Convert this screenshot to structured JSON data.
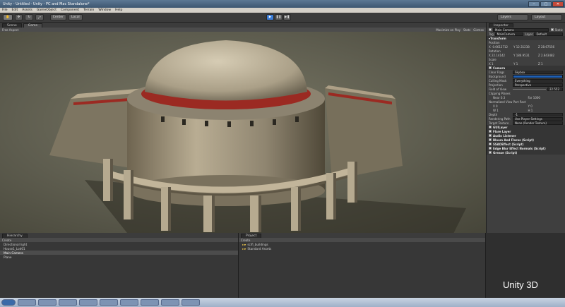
{
  "window": {
    "title": "Unity - Untitled - Unity - PC and Mac Standalone*"
  },
  "menu": [
    "File",
    "Edit",
    "Assets",
    "GameObject",
    "Component",
    "Terrain",
    "Window",
    "Help"
  ],
  "toolbar": {
    "center": "Center",
    "local": "Local",
    "layers": "Layers",
    "layout": "Layout"
  },
  "tabs": {
    "scene": "Scene",
    "game": "Game"
  },
  "scene_bar": {
    "left": "Free Aspect",
    "maximize": "Maximize on Play",
    "stats": "Stats",
    "gizmos": "Gizmos"
  },
  "inspector": {
    "tab": "Inspector",
    "object": "Main Camera",
    "static": "Static",
    "tag_label": "Tag",
    "tag_value": "MainCamera",
    "layer_label": "Layer",
    "layer_value": "Default",
    "transform": "Transform",
    "position_label": "Position",
    "pos": [
      "X -0.6612712",
      "Y 12.31238",
      "Z 28.67556"
    ],
    "rotation_label": "Rotation",
    "rot": [
      "X 22.14142",
      "Y 186.9531",
      "Z 2.843482"
    ],
    "scale_label": "Scale",
    "scale": [
      "X 1",
      "Y 1",
      "Z 1"
    ],
    "camera": "Camera",
    "clear_flags_label": "Clear Flags",
    "clear_flags_value": "Skybox",
    "background_label": "Background",
    "culling_label": "Culling Mask",
    "culling_value": "Everything",
    "projection_label": "Projection",
    "projection_value": "Perspective",
    "fov_label": "Field of View",
    "fov_value": "22.552",
    "clipping_label": "Clipping Planes",
    "near": "Near 0.3",
    "far": "Far 1000",
    "rect_label": "Normalized View Port Rect",
    "rect": [
      "X 0",
      "Y 0",
      "W 1",
      "H 1"
    ],
    "depth_label": "Depth",
    "depth_value": "-1",
    "render_path_label": "Rendering Path",
    "render_path_value": "Use Player Settings",
    "target_label": "Target Texture",
    "target_value": "None (Render Texture)",
    "components": [
      "GUILayer",
      "Flare Layer",
      "Audio Listener",
      "Bloom And Flares (Script)",
      "SSAOEffect (Script)",
      "Edge Blur Effect Normals (Script)",
      "Grease (Script)"
    ]
  },
  "hierarchy": {
    "tab": "Hierarchy",
    "create": "Create",
    "items": [
      "Directional light",
      "House1_Lod01",
      "Main Camera",
      "Plane"
    ]
  },
  "project": {
    "tab": "Project",
    "create": "Create",
    "items": [
      "scifi_buildings",
      "Standard Assets"
    ]
  },
  "brand": "Unity 3D"
}
